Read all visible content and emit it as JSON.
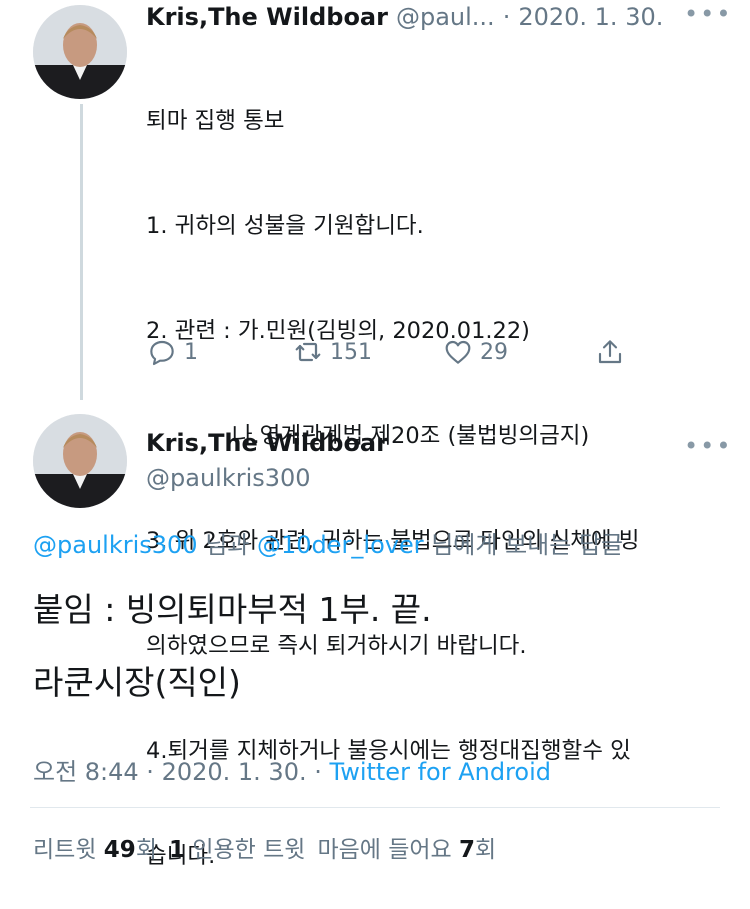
{
  "tweet1": {
    "display_name": "Kris,The Wildboar",
    "handle": "@paul...",
    "date_separator": "·",
    "date": "2020. 1. 30.",
    "more_icon": "more-icon",
    "lines": [
      "퇴마 집행 통보",
      "1. 귀하의 성불을 기원합니다.",
      "2. 관련 : 가.민원(김빙의, 2020.01.22)",
      "            나.영계관계법 제20조 (불법빙의금지)",
      "3. 위 2호와 관련, 귀하는 불법으로 타인의 신체에 빙",
      "의하였으므로 즉시 퇴거하시기 바랍니다.",
      "4.퇴거를 지체하거나 불응시에는 행정대집행할수 있",
      "습니다."
    ],
    "actions": {
      "reply_count": "1",
      "retweet_count": "151",
      "like_count": "29"
    }
  },
  "tweet2": {
    "display_name": "Kris,The Wildboar",
    "handle": "@paulkris300",
    "reply_to": {
      "mention1": "@paulkris300",
      "mid": " 님과 ",
      "mention2": "@10der_lover",
      "suffix": " 님에게 보내는 답글"
    },
    "line1": "붙임 : 빙의퇴마부적 1부. 끝.",
    "line2": "라쿤시장(직인)",
    "meta": {
      "time": "오전 8:44 · 2020. 1. 30. · ",
      "source": "Twitter for Android"
    },
    "stats": {
      "retweet_label": "리트윗",
      "retweet_count": "49",
      "retweet_unit": "회",
      "quote_count": "1",
      "quote_label": "인용한 트윗",
      "like_label": "마음에 들어요",
      "like_count": "7",
      "like_unit": "회"
    }
  },
  "colors": {
    "accent": "#1da1f2",
    "muted": "#657786",
    "text": "#14171a",
    "divider": "#e1e8ed"
  }
}
